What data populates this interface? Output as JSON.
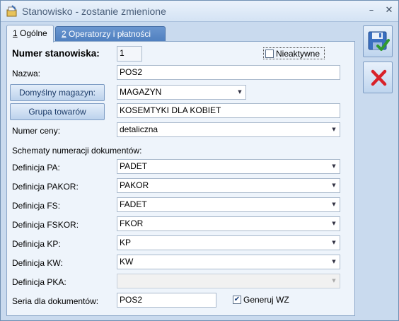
{
  "window": {
    "title": "Stanowisko - zostanie zmienione"
  },
  "tabs": [
    {
      "hotkey": "1",
      "label": " Ogólne"
    },
    {
      "hotkey": "2",
      "label": " Operatorzy i płatności"
    }
  ],
  "form": {
    "numer_label": "Numer stanowiska:",
    "numer_value": "1",
    "nieaktywne_label": "Nieaktywne",
    "nieaktywne_checked": false,
    "nazwa_label": "Nazwa:",
    "nazwa_value": "POS2",
    "magazyn_button": "Domyślny magazyn:",
    "magazyn_value": "MAGAZYN",
    "grupa_button": "Grupa towarów",
    "grupa_value": "KOSEMTYKI DLA KOBIET",
    "cena_label": "Numer ceny:",
    "cena_value": "detaliczna",
    "schematy_label": "Schematy numeracji dokumentów:",
    "definitions": [
      {
        "label": "Definicja PA:",
        "value": "PADET"
      },
      {
        "label": "Definicja PAKOR:",
        "value": "PAKOR"
      },
      {
        "label": "Definicja FS:",
        "value": "FADET"
      },
      {
        "label": "Definicja FSKOR:",
        "value": "FKOR"
      },
      {
        "label": "Definicja KP:",
        "value": "KP"
      },
      {
        "label": "Definicja KW:",
        "value": "KW"
      },
      {
        "label": "Definicja PKA:",
        "value": ""
      }
    ],
    "seria_label": "Seria dla dokumentów:",
    "seria_value": "POS2",
    "generuj_label": "Generuj WZ",
    "generuj_checked": true
  },
  "icons": {
    "save": "save-icon",
    "cancel": "cancel-icon",
    "accent": "#4f7fbf",
    "cancel_color": "#d8222a"
  }
}
